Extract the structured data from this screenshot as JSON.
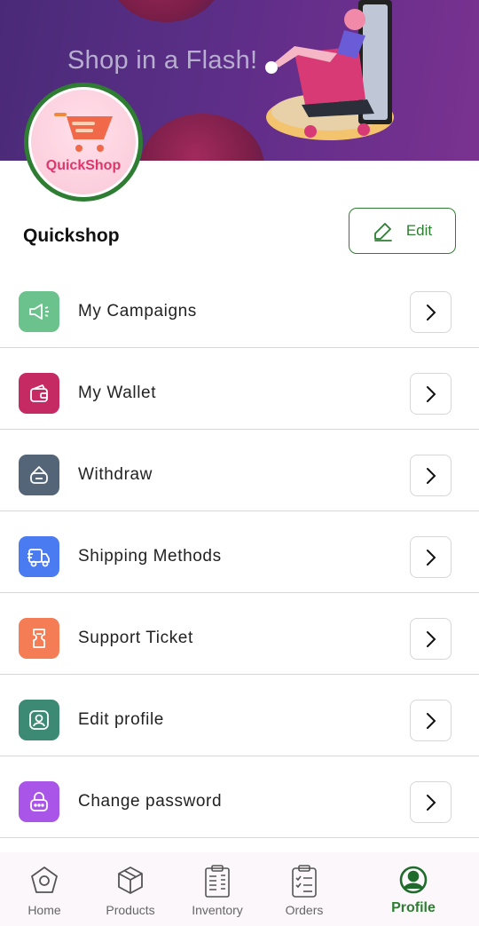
{
  "banner": {
    "slogan": "Shop in a Flash!"
  },
  "logo": {
    "text": "QuickShop"
  },
  "profile": {
    "name": "Quickshop",
    "edit_label": "Edit"
  },
  "colors": {
    "accent": "#2e7d32"
  },
  "menu": [
    {
      "label": "My Campaigns",
      "icon": "megaphone-icon",
      "color": "#6cc28d"
    },
    {
      "label": "My Wallet",
      "icon": "wallet-icon",
      "color": "#c52a62"
    },
    {
      "label": "Withdraw",
      "icon": "withdraw-icon",
      "color": "#546577"
    },
    {
      "label": "Shipping Methods",
      "icon": "truck-icon",
      "color": "#4a7bf0"
    },
    {
      "label": "Support Ticket",
      "icon": "ticket-icon",
      "color": "#f57d55"
    },
    {
      "label": "Edit profile",
      "icon": "profile-card-icon",
      "color": "#3c8a74"
    },
    {
      "label": "Change password",
      "icon": "lock-icon",
      "color": "#a855e8"
    }
  ],
  "tabs": [
    {
      "label": "Home",
      "icon": "home-icon"
    },
    {
      "label": "Products",
      "icon": "box-icon"
    },
    {
      "label": "Inventory",
      "icon": "inventory-icon"
    },
    {
      "label": "Orders",
      "icon": "clipboard-icon"
    },
    {
      "label": "Profile",
      "icon": "user-circle-icon",
      "active": true
    }
  ]
}
